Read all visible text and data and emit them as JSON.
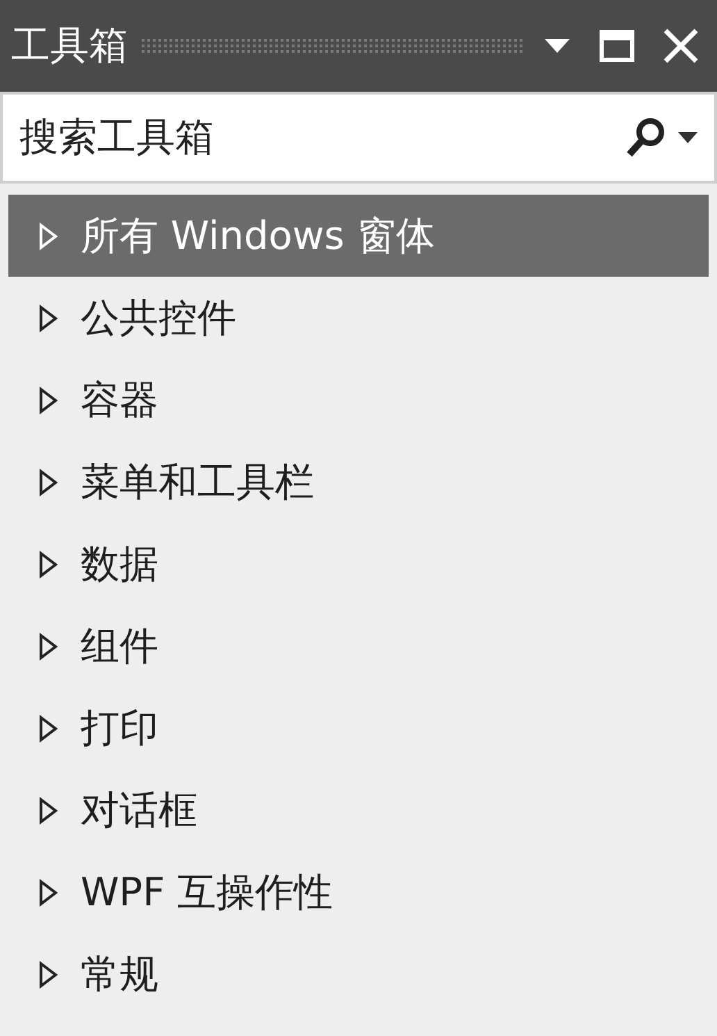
{
  "window": {
    "title": "工具箱"
  },
  "search": {
    "placeholder": "搜索工具箱"
  },
  "items": [
    {
      "label": "所有 Windows 窗体",
      "selected": true,
      "expanded": false
    },
    {
      "label": "公共控件",
      "selected": false,
      "expanded": false
    },
    {
      "label": "容器",
      "selected": false,
      "expanded": false
    },
    {
      "label": "菜单和工具栏",
      "selected": false,
      "expanded": false
    },
    {
      "label": "数据",
      "selected": false,
      "expanded": false
    },
    {
      "label": "组件",
      "selected": false,
      "expanded": false
    },
    {
      "label": "打印",
      "selected": false,
      "expanded": false
    },
    {
      "label": "对话框",
      "selected": false,
      "expanded": false
    },
    {
      "label": "WPF 互操作性",
      "selected": false,
      "expanded": false
    },
    {
      "label": "常规",
      "selected": false,
      "expanded": false
    }
  ]
}
